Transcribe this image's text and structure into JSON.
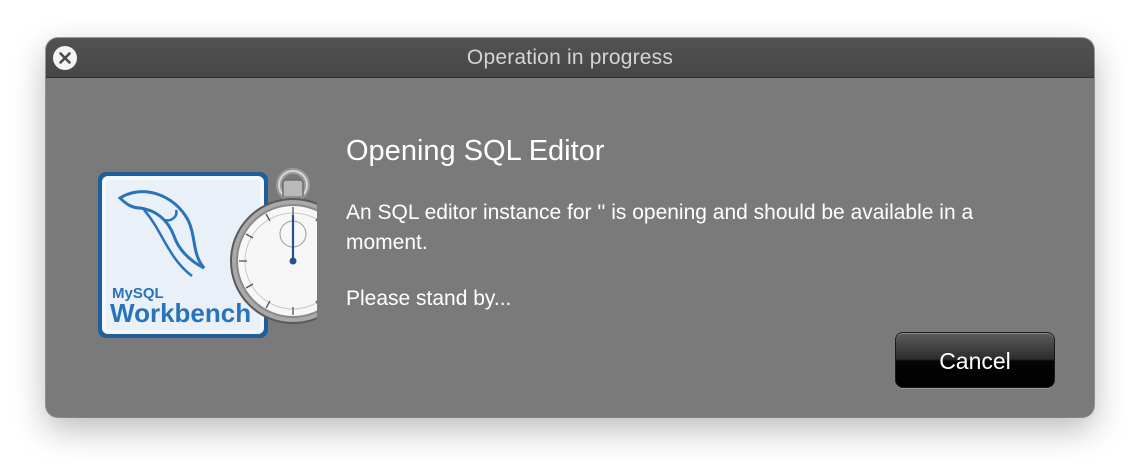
{
  "window": {
    "title": "Operation in progress"
  },
  "logo": {
    "brand_small": "MySQL",
    "brand_large": "Workbench",
    "icon": "mysql-workbench-stopwatch-icon"
  },
  "content": {
    "heading": "Opening SQL Editor",
    "message": "An SQL editor instance for '' is opening and should be available in a moment.",
    "standby": "Please stand by..."
  },
  "buttons": {
    "cancel_label": "Cancel"
  },
  "colors": {
    "dialog_background": "#7a7a7a",
    "titlebar_background": "#4c4c4c",
    "logo_blue": "#2a73b8"
  }
}
